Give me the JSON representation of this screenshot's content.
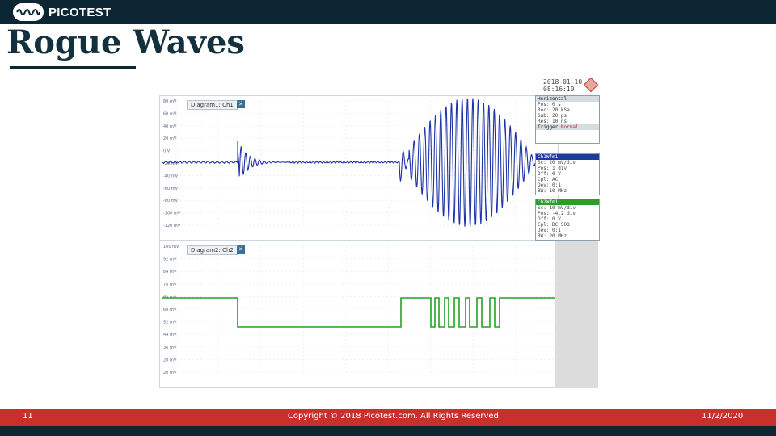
{
  "brand": {
    "name": "PICOTEST"
  },
  "slide": {
    "title": "Rogue Waves",
    "number": "11",
    "copyright": "Copyright © 2018 Picotest.com. All Rights Reserved.",
    "date": "11/2/2020"
  },
  "scope": {
    "stamp_date": "2018-01-10",
    "stamp_time": "08:16:10",
    "diagram1": {
      "label": "Diagram1: Ch1",
      "close": "✕"
    },
    "diagram2": {
      "label": "Diagram2: Ch2",
      "close": "✕"
    },
    "horizontal": {
      "title": "Horizontal",
      "lines": [
        "Pos: 0 s",
        "Rec: 20 kSa",
        "Sab: 20 ps",
        "Res: 10 ns"
      ]
    },
    "trigger": {
      "title": "Trigger",
      "mode": "Normal"
    },
    "ch1": {
      "title": "Ch1Wfm1",
      "lines": [
        "Sc: 20 mV/div",
        "Pos: 1 div",
        "Off: 0 V",
        "Cpl: AC",
        "Dev: 0:1",
        "BW: 10 MHz"
      ]
    },
    "ch2": {
      "title": "Ch2Wfm1",
      "lines": [
        "Sc: 10 mV/div",
        "Pos: -4.2 div",
        "Off: 0 V",
        "Cpl: DC 50Ω",
        "Dev: 0:1",
        "BW: 20 MHz"
      ]
    },
    "diagram1_yticks": [
      "80 mV",
      "60 mV",
      "40 mV",
      "20 mV",
      "0 V",
      "-20 mV",
      "-40 mV",
      "-60 mV",
      "-80 mV",
      "-100 mV",
      "-120 mV"
    ],
    "diagram2_yticks": [
      "100 mV",
      "92 mV",
      "84 mV",
      "76 mV",
      "68 mV",
      "60 mV",
      "52 mV",
      "44 mV",
      "36 mV",
      "28 mV",
      "20 mV"
    ]
  },
  "colors": {
    "ch1": "#1f32a8",
    "ch2": "#22a322",
    "topbar": "#0c2633",
    "footer": "#c9302c"
  }
}
